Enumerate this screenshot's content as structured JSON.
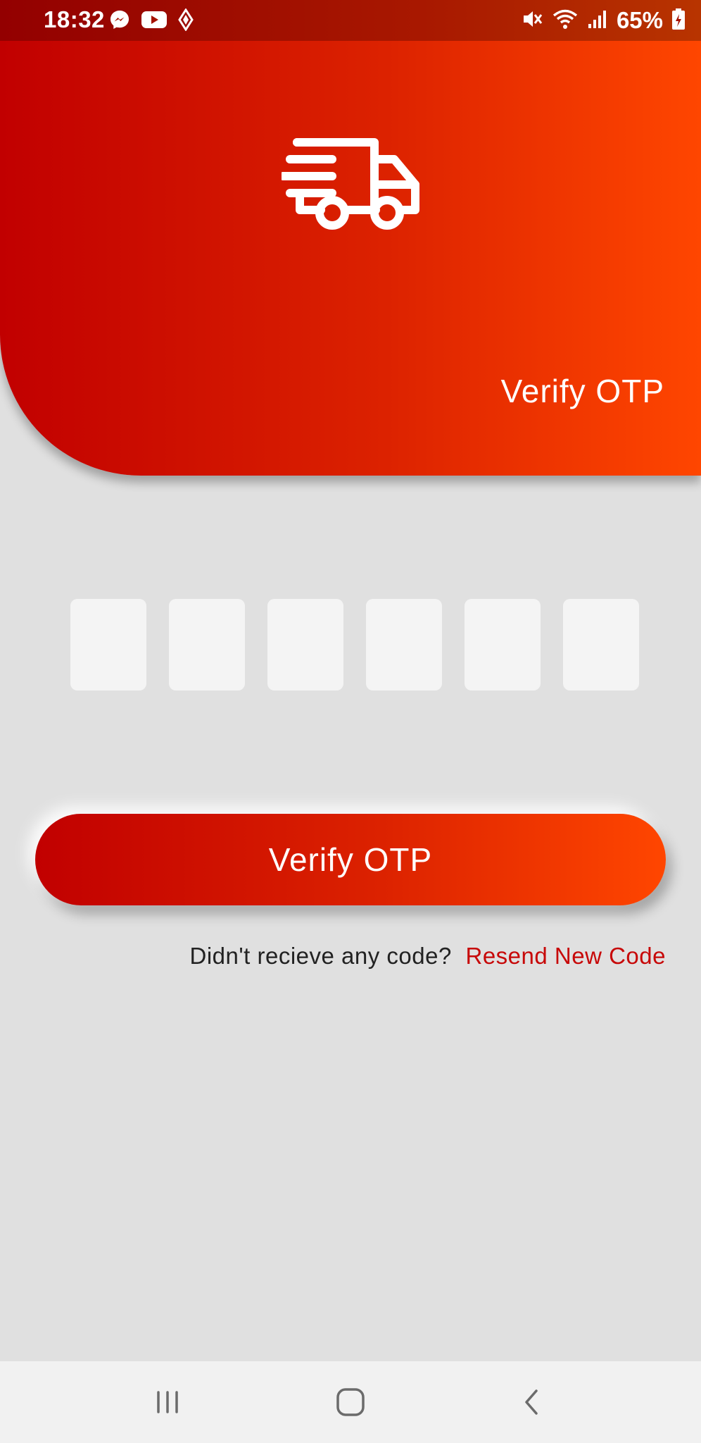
{
  "status_bar": {
    "time": "18:32",
    "battery_percent": "65%",
    "left_icons": [
      "messenger-icon",
      "youtube-icon",
      "navigation-icon"
    ],
    "right_icons": [
      "mute-icon",
      "wifi-icon",
      "signal-icon",
      "battery-charging-icon"
    ]
  },
  "header": {
    "icon": "delivery-truck-icon",
    "title": "Verify OTP",
    "gradient": [
      "#c10000",
      "#ff4600"
    ]
  },
  "otp": {
    "digits": [
      "",
      "",
      "",
      "",
      "",
      ""
    ]
  },
  "actions": {
    "verify_label": "Verify OTP",
    "resend_question": "Didn't recieve any code?",
    "resend_link": "Resend New Code"
  },
  "colors": {
    "accent": "#c70808",
    "background": "#e0e0e0",
    "otp_box": "#f4f4f4"
  },
  "nav_bar": {
    "buttons": [
      "recent-apps-icon",
      "home-icon",
      "back-icon"
    ]
  }
}
